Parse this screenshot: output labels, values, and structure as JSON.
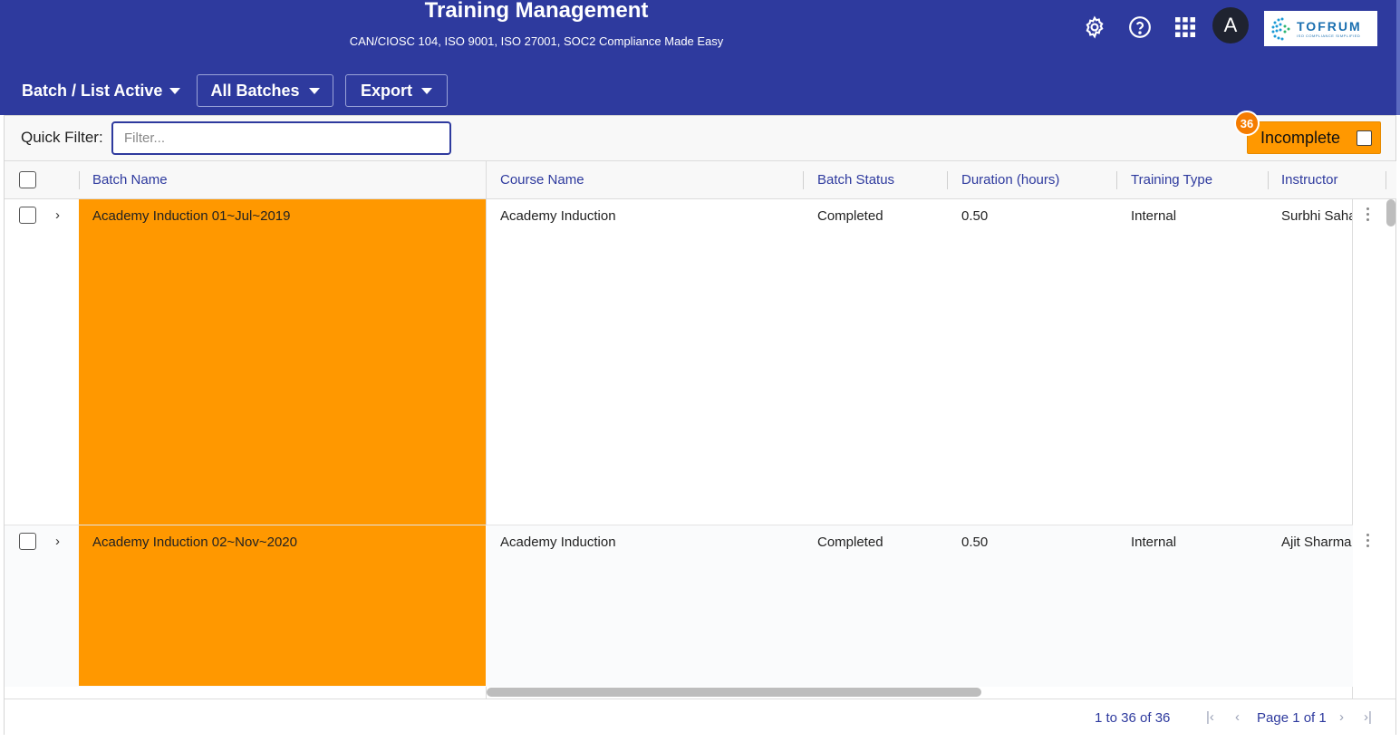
{
  "header": {
    "title": "Training Management",
    "subtitle": "CAN/CIOSC 104, ISO 9001, ISO 27001, SOC2 Compliance Made Easy",
    "avatar_initial": "A",
    "logo_name": "TOFRUM",
    "logo_tag": "ISO COMPLIANCE SIMPLIFIED",
    "icons": [
      "gear-icon",
      "help-icon",
      "apps-grid-icon"
    ]
  },
  "toolbar": {
    "menu_label": "Batch / List Active",
    "batches_label": "All Batches",
    "export_label": "Export"
  },
  "filter": {
    "label": "Quick Filter:",
    "placeholder": "Filter...",
    "incomplete_label": "Incomplete",
    "incomplete_count": "36"
  },
  "grid": {
    "columns": [
      "Batch Name",
      "Course Name",
      "Batch Status",
      "Duration (hours)",
      "Training Type",
      "Instructor"
    ],
    "rows": [
      {
        "batch": "Academy Induction 01~Jul~2019",
        "course": "Academy Induction",
        "status": "Completed",
        "duration": "0.50",
        "type": "Internal",
        "instructor": "Surbhi Saha"
      },
      {
        "batch": "Academy Induction 02~Nov~2020",
        "course": "Academy Induction",
        "status": "Completed",
        "duration": "0.50",
        "type": "Internal",
        "instructor": "Ajit Sharma"
      }
    ],
    "highlight_color": "#ff9800"
  },
  "footer": {
    "range": "1 to 36 of 36",
    "page": "Page 1 of 1"
  },
  "colors": {
    "primary": "#2e3a9e",
    "accent": "#ff9800"
  }
}
